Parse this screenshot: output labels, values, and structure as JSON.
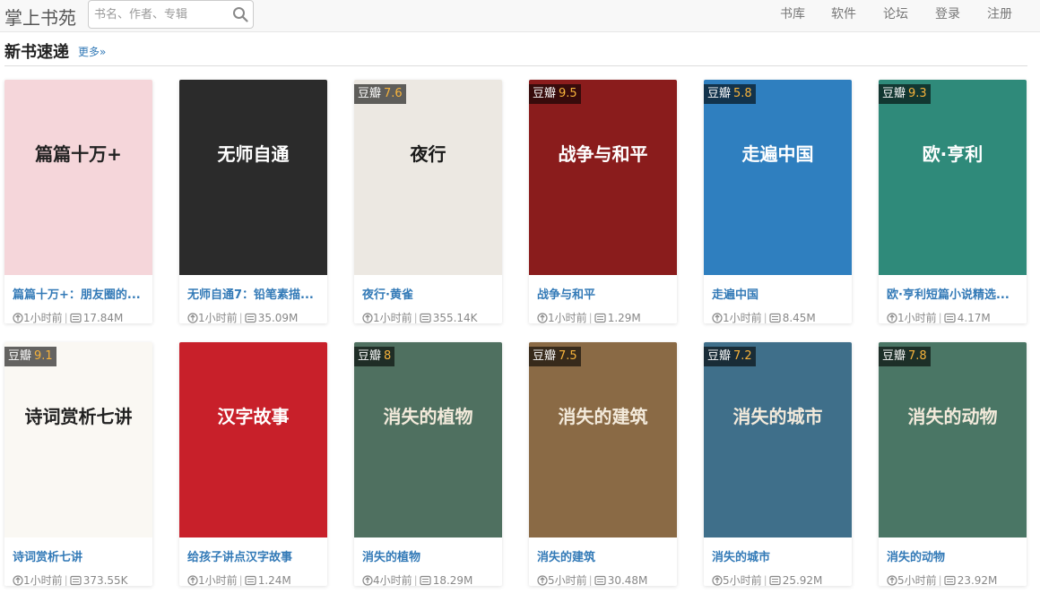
{
  "header": {
    "brand": "掌上书苑",
    "search_placeholder": "书名、作者、专辑",
    "nav": [
      "书库",
      "软件",
      "论坛",
      "登录",
      "注册"
    ]
  },
  "section": {
    "title": "新书速递",
    "more": "更多»"
  },
  "rating_label": "豆瓣",
  "colors": {
    "accent": "#337ab7",
    "score": "#f7b33b"
  },
  "books": [
    {
      "name": "篇篇十万+：朋友圈的...",
      "rating": "",
      "time": "1小时前",
      "size": "17.84M",
      "cover_text": "篇篇十万+",
      "bg": "#f5d6da",
      "fg": "#222"
    },
    {
      "name": "无师自通7：铅笔素描...",
      "rating": "",
      "time": "1小时前",
      "size": "35.09M",
      "cover_text": "无师自通",
      "bg": "#2b2b2b",
      "fg": "#ffffff"
    },
    {
      "name": "夜行·黄雀",
      "rating": "7.6",
      "time": "1小时前",
      "size": "355.14K",
      "cover_text": "夜行",
      "bg": "#ece8e2",
      "fg": "#1a1a1a"
    },
    {
      "name": "战争与和平",
      "rating": "9.5",
      "time": "1小时前",
      "size": "1.29M",
      "cover_text": "战争与和平",
      "bg": "#8a1c1c",
      "fg": "#ffffff"
    },
    {
      "name": "走遍中国",
      "rating": "5.8",
      "time": "1小时前",
      "size": "8.45M",
      "cover_text": "走遍中国",
      "bg": "#2f7fbf",
      "fg": "#ffffff"
    },
    {
      "name": "欧·亨利短篇小说精选...",
      "rating": "9.3",
      "time": "1小时前",
      "size": "4.17M",
      "cover_text": "欧·亨利",
      "bg": "#2f8a7a",
      "fg": "#ffffff"
    },
    {
      "name": "诗词赏析七讲",
      "rating": "9.1",
      "time": "1小时前",
      "size": "373.55K",
      "cover_text": "诗词赏析七讲",
      "bg": "#faf8f3",
      "fg": "#222"
    },
    {
      "name": "给孩子讲点汉字故事",
      "rating": "",
      "time": "1小时前",
      "size": "1.24M",
      "cover_text": "汉字故事",
      "bg": "#c8202a",
      "fg": "#ffffff"
    },
    {
      "name": "消失的植物",
      "rating": "8",
      "time": "4小时前",
      "size": "18.29M",
      "cover_text": "消失的植物",
      "bg": "#4f7060",
      "fg": "#f3eadb"
    },
    {
      "name": "消失的建筑",
      "rating": "7.5",
      "time": "5小时前",
      "size": "30.48M",
      "cover_text": "消失的建筑",
      "bg": "#8a6a45",
      "fg": "#f3eadb"
    },
    {
      "name": "消失的城市",
      "rating": "7.2",
      "time": "5小时前",
      "size": "25.92M",
      "cover_text": "消失的城市",
      "bg": "#3f6f8a",
      "fg": "#f3eadb"
    },
    {
      "name": "消失的动物",
      "rating": "7.8",
      "time": "5小时前",
      "size": "23.92M",
      "cover_text": "消失的动物",
      "bg": "#4a7665",
      "fg": "#f3eadb"
    }
  ]
}
